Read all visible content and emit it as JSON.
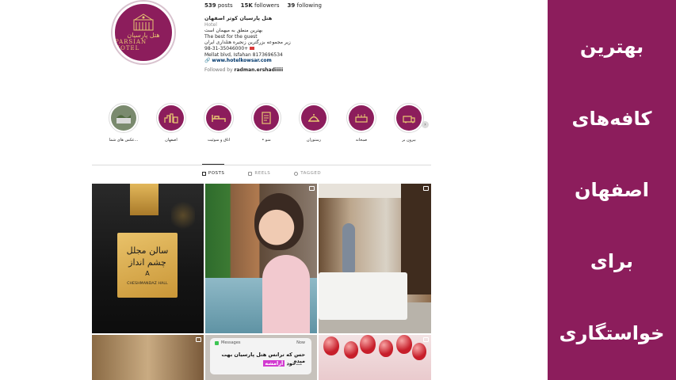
{
  "profile": {
    "avatar": {
      "logo_fa": "هتل پارسیان",
      "logo_en": "PARSIAN HOTEL"
    },
    "stats": {
      "posts_count": "539",
      "posts_label": "posts",
      "followers_count": "15K",
      "followers_label": "followers",
      "following_count": "39",
      "following_label": "following"
    },
    "bio": {
      "name": "هتل پارسیان کوثر اصفهان",
      "category": "Hotel",
      "lines": [
        "بهترین منطق به میهمان است",
        "The best for the guest",
        "زیر مجموعه بزرگترین زنجیره هتلداری ایران",
        "98-31-35046000+"
      ],
      "address": "Mellat blvd, Isfahan 8173696534",
      "link": "www.hotelkowsar.com",
      "followed_prefix": "Followed by",
      "followed_user": "radman.ershadiiiii"
    },
    "highlights": [
      {
        "label": "عکس های شما...",
        "icon": "photo-icon"
      },
      {
        "label": "اصفهان",
        "icon": "city-icon"
      },
      {
        "label": "اتاق و سوئیت",
        "icon": "bed-icon"
      },
      {
        "label": "• منو",
        "icon": "menu-icon"
      },
      {
        "label": "رستوران",
        "icon": "restaurant-icon"
      },
      {
        "label": "صبحانه",
        "icon": "breakfast-icon"
      },
      {
        "label": "بیرون بر",
        "icon": "takeaway-icon"
      }
    ],
    "tabs": [
      {
        "label": "POSTS",
        "icon": "grid-icon",
        "active": true
      },
      {
        "label": "REELS",
        "icon": "reels-icon",
        "active": false
      },
      {
        "label": "TAGGED",
        "icon": "tag-icon",
        "active": false
      }
    ],
    "posts": {
      "hall_sign": {
        "line1": "سالن مجلل",
        "line2": "چشم انداز",
        "line3": "A",
        "line4": "CHESHMANDAZ HALL"
      },
      "message": {
        "app": "Messages",
        "time": "Now",
        "line1": "حس که ترانس هتل پارسیان بهت میده",
        "line2_a": "خود",
        "line2_b": "آرامشه",
        "line2_c": "..."
      }
    }
  },
  "side_panel": {
    "words": [
      "بهترین",
      "کافه‌های",
      "اصفهان",
      "برای",
      "خواستگاری"
    ]
  },
  "colors": {
    "brand": "#8c1d5c",
    "gold": "#e8c772",
    "link": "#00376b"
  }
}
